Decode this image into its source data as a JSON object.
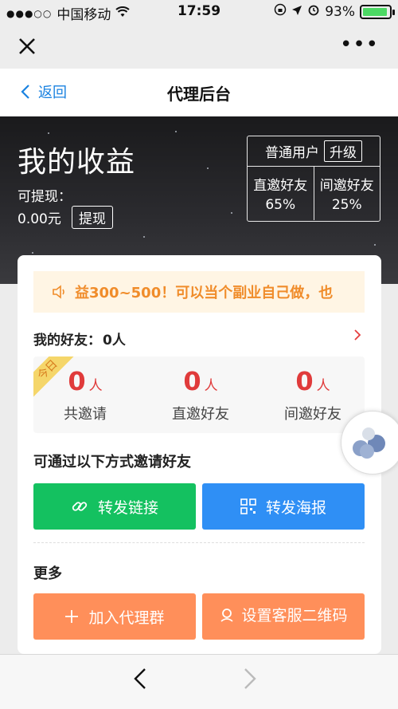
{
  "status_bar": {
    "carrier": "中国移动",
    "time": "17:59",
    "battery": "93%",
    "battery_level": 0.93
  },
  "nav": {
    "back_label": "返回",
    "title": "代理后台"
  },
  "hero": {
    "title": "我的收益",
    "withdrawable_label": "可提现：",
    "amount": "0.00元",
    "withdraw_button": "提现",
    "user_level": "普通用户",
    "upgrade_button": "升级",
    "direct_invite_label": "直邀好友",
    "direct_invite_rate": "65%",
    "indirect_invite_label": "间邀好友",
    "indirect_invite_rate": "25%"
  },
  "notice": {
    "text": "益300~500！可以当个副业自己做，也"
  },
  "friends": {
    "label": "我的好友：",
    "count": "0人"
  },
  "stats": {
    "ribbon": "今日",
    "items": [
      {
        "value": "0",
        "unit": "人",
        "label": "共邀请"
      },
      {
        "value": "0",
        "unit": "人",
        "label": "直邀好友"
      },
      {
        "value": "0",
        "unit": "人",
        "label": "间邀好友"
      }
    ]
  },
  "invite": {
    "title": "可通过以下方式邀请好友",
    "share_link": "转发链接",
    "share_poster": "转发海报"
  },
  "more": {
    "title": "更多",
    "join_group": "加入代理群",
    "service_qr": "设置客服二维码"
  },
  "colors": {
    "accent_blue": "#1a82e0",
    "green": "#14c160",
    "blue": "#2f8ff5",
    "orange": "#ff8f5a",
    "red": "#e03b3b",
    "notice_text": "#f08c2a"
  }
}
